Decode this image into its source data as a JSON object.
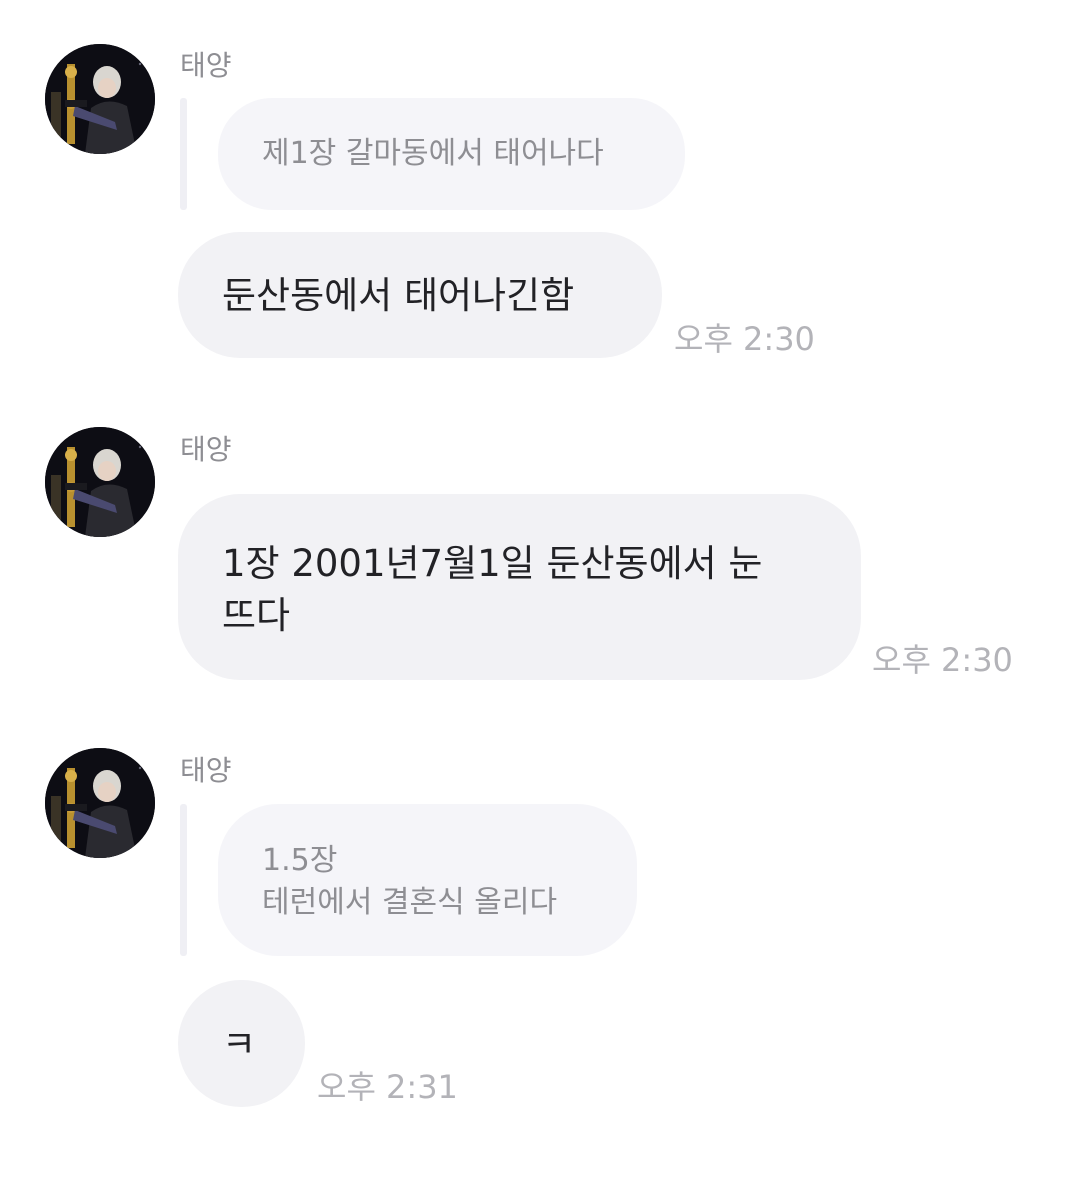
{
  "messages": [
    {
      "sender": "태양",
      "reply": "제1장 갈마동에서 태어나다",
      "text": "둔산동에서 태어나긴함",
      "time": "오후 2:30"
    },
    {
      "sender": "태양",
      "text_line1": "1장 2001년7월1일 둔산동에서 눈",
      "text_line2": "뜨다",
      "time": "오후 2:30"
    },
    {
      "sender": "태양",
      "reply_line1": "1.5장",
      "reply_line2": "테런에서 결혼식 올리다",
      "text": "ㅋ",
      "time": "오후 2:31"
    }
  ],
  "colors": {
    "bubble": "#f2f2f5",
    "reply_bubble": "#f5f5f9",
    "reply_bar": "#efeff4",
    "timestamp": "#b3b3b8",
    "sender_name": "#8e8e93"
  },
  "icons": {
    "avatar": "profile-photo-avatar"
  }
}
